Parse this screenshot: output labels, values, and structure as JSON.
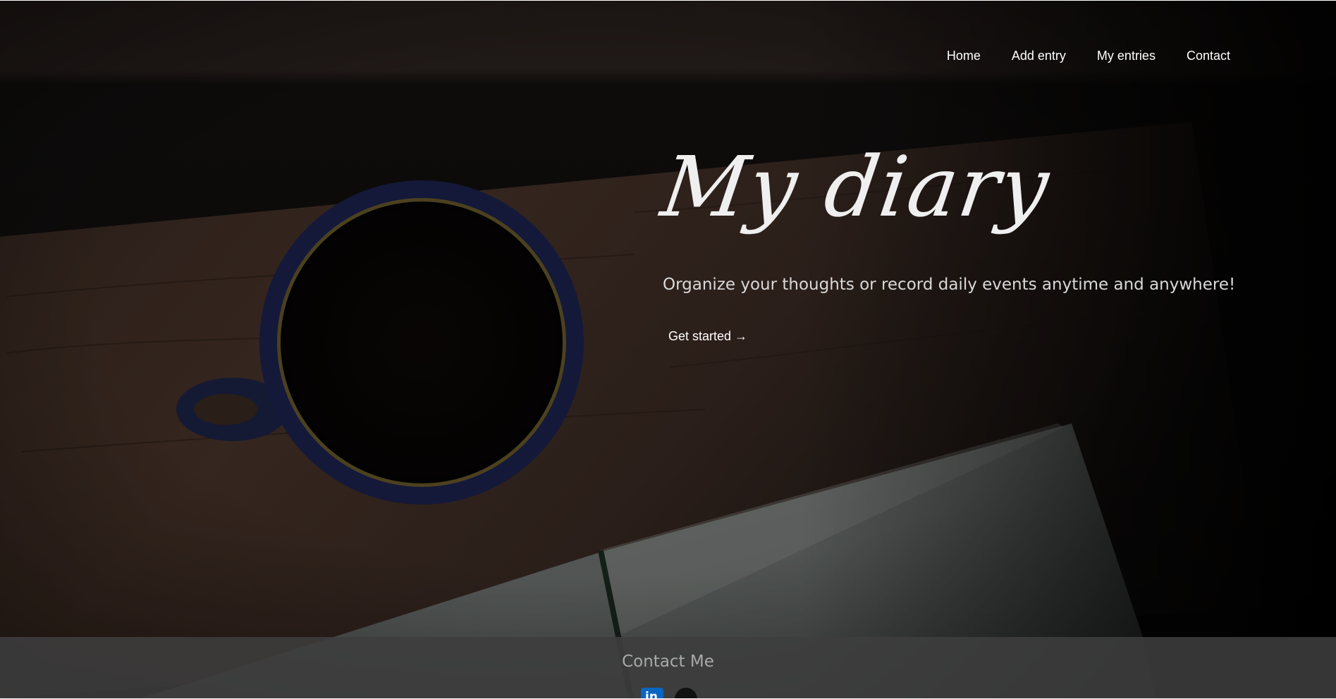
{
  "nav": {
    "items": [
      {
        "label": "Home"
      },
      {
        "label": "Add entry"
      },
      {
        "label": "My entries"
      },
      {
        "label": "Contact"
      }
    ]
  },
  "hero": {
    "title": "My diary",
    "subtitle": "Organize your thoughts or record daily events anytime and anywhere!",
    "cta_label": "Get started →",
    "background": "dark wooden desk with coffee mug and open notebook"
  },
  "footer": {
    "title": "Contact Me",
    "social": [
      {
        "icon": "linkedin-icon"
      },
      {
        "icon": "github-icon"
      }
    ]
  },
  "colors": {
    "text": "#ffffff",
    "footer_bg": "#3e3e3e",
    "footer_text": "#a9a9a9",
    "linkedin": "#0a66c2"
  }
}
